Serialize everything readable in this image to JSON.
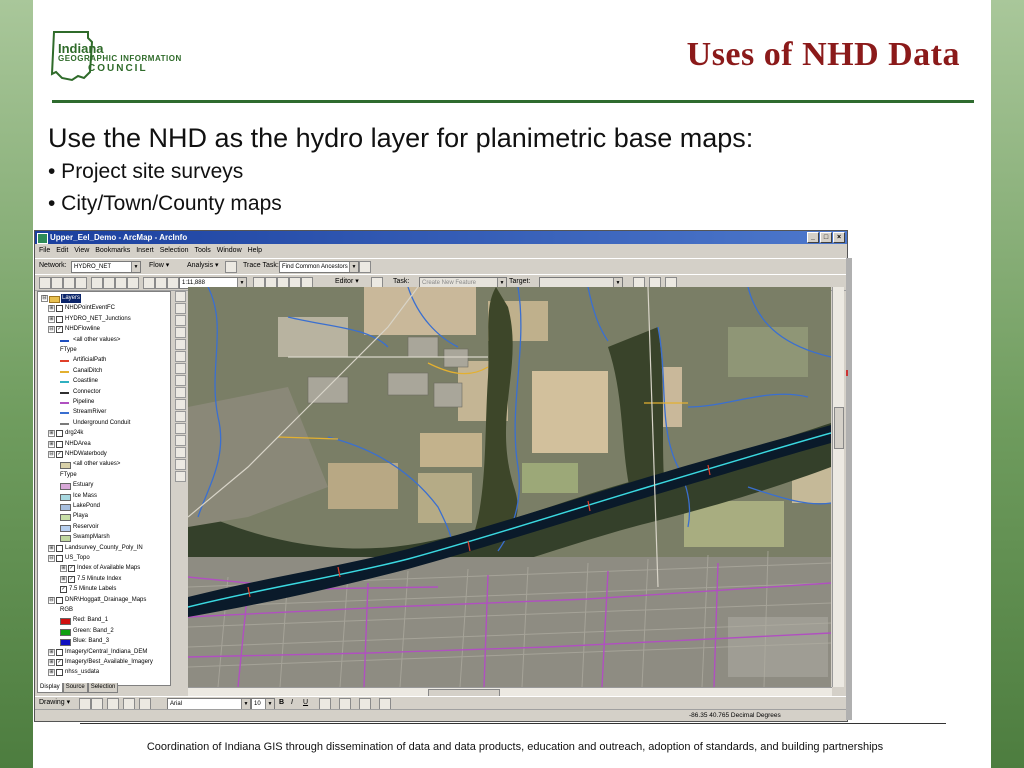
{
  "slide": {
    "title": "Uses of NHD Data",
    "logo_text": {
      "line1": "Indiana",
      "line2": "GEOGRAPHIC INFORMATION",
      "line3": "COUNCIL"
    },
    "heading": "Use the NHD as the hydro layer for planimetric base maps:",
    "bullets": [
      "• Project site surveys",
      "• City/Town/County maps"
    ],
    "footer": "Coordination of Indiana GIS through dissemination of data and data products, education and outreach, adoption of standards, and building partnerships",
    "colors": {
      "title": "#8b1a1a",
      "rule": "#2e6b2e",
      "side_bars": "#6f9c5e"
    }
  },
  "app": {
    "window_title": "Upper_Eel_Demo - ArcMap - ArcInfo",
    "window_buttons": [
      "_",
      "□",
      "×"
    ],
    "menus": [
      "File",
      "Edit",
      "View",
      "Bookmarks",
      "Insert",
      "Selection",
      "Tools",
      "Window",
      "Help"
    ],
    "network_label": "Network:",
    "network_value": "HYDRO_NET",
    "flow_label": "Flow ▾",
    "analysis_label": "Analysis ▾",
    "trace_task_label": "Trace Task:",
    "trace_task_value": "Find Common Ancestors",
    "scale_value": "1:11,888",
    "editor_label": "Editor ▾",
    "task_label": "Task:",
    "task_value": "Create New Feature",
    "target_label": "Target:",
    "draw_label": "Drawing ▾",
    "font_value": "Arial",
    "font_size": "10",
    "format_buttons": [
      "B",
      "I",
      "U"
    ],
    "coordinates": "-86.35  40.765 Decimal Degrees",
    "toc_tabs": [
      "Display",
      "Source",
      "Selection"
    ],
    "toc": [
      {
        "label": "Layers",
        "level": 0,
        "kind": "group",
        "expander": "⊟",
        "selected": true
      },
      {
        "label": "NHDPointEventFC",
        "level": 1,
        "kind": "layer",
        "expander": "⊞",
        "checked": false
      },
      {
        "label": "HYDRO_NET_Junctions",
        "level": 1,
        "kind": "layer",
        "expander": "⊞",
        "checked": false
      },
      {
        "label": "NHDFlowline",
        "level": 1,
        "kind": "layer",
        "expander": "⊟",
        "checked": true
      },
      {
        "label": "<all other values>",
        "level": 2,
        "kind": "legend",
        "symbol": "line",
        "color": "#1f4fbf"
      },
      {
        "label": "FType",
        "level": 2,
        "kind": "legend",
        "symbol": "none"
      },
      {
        "label": "ArtificialPath",
        "level": 2,
        "kind": "legend",
        "symbol": "line",
        "color": "#e0402a"
      },
      {
        "label": "CanalDitch",
        "level": 2,
        "kind": "legend",
        "symbol": "line",
        "color": "#e3b030"
      },
      {
        "label": "Coastline",
        "level": 2,
        "kind": "legend",
        "symbol": "line",
        "color": "#30b0c0"
      },
      {
        "label": "Connector",
        "level": 2,
        "kind": "legend",
        "symbol": "line",
        "color": "#303030"
      },
      {
        "label": "Pipeline",
        "level": 2,
        "kind": "legend",
        "symbol": "line",
        "color": "#b050c0"
      },
      {
        "label": "StreamRiver",
        "level": 2,
        "kind": "legend",
        "symbol": "line",
        "color": "#3a6fd0"
      },
      {
        "label": "Underground Conduit",
        "level": 2,
        "kind": "legend",
        "symbol": "line",
        "color": "#7a7a7a"
      },
      {
        "label": "drg24k",
        "level": 1,
        "kind": "layer",
        "expander": "⊞",
        "checked": false
      },
      {
        "label": "NHDArea",
        "level": 1,
        "kind": "layer",
        "expander": "⊞",
        "checked": false
      },
      {
        "label": "NHDWaterbody",
        "level": 1,
        "kind": "layer",
        "expander": "⊟",
        "checked": true
      },
      {
        "label": "<all other values>",
        "level": 2,
        "kind": "legend",
        "symbol": "fill",
        "color": "#d8d0a8"
      },
      {
        "label": "FType",
        "level": 2,
        "kind": "legend",
        "symbol": "none"
      },
      {
        "label": "Estuary",
        "level": 2,
        "kind": "legend",
        "symbol": "fill",
        "color": "#d8a8d8"
      },
      {
        "label": "Ice Mass",
        "level": 2,
        "kind": "legend",
        "symbol": "fill",
        "color": "#a8d8e0"
      },
      {
        "label": "LakePond",
        "level": 2,
        "kind": "legend",
        "symbol": "fill",
        "color": "#a8c0e0"
      },
      {
        "label": "Playa",
        "level": 2,
        "kind": "legend",
        "symbol": "fill",
        "color": "#c8e0a8"
      },
      {
        "label": "Reservoir",
        "level": 2,
        "kind": "legend",
        "symbol": "fill",
        "color": "#b8d0f0"
      },
      {
        "label": "SwampMarsh",
        "level": 2,
        "kind": "legend",
        "symbol": "fill",
        "color": "#c0d8a0"
      },
      {
        "label": "Landsurvey_County_Poly_IN",
        "level": 1,
        "kind": "layer",
        "expander": "⊞",
        "checked": false
      },
      {
        "label": "US_Topo",
        "level": 1,
        "kind": "layer",
        "expander": "⊟",
        "checked": false
      },
      {
        "label": "Index of Available Maps",
        "level": 2,
        "kind": "layer",
        "expander": "⊞",
        "checked": true
      },
      {
        "label": "7.5 Minute Index",
        "level": 2,
        "kind": "layer",
        "expander": "⊞",
        "checked": true
      },
      {
        "label": "7.5 Minute Labels",
        "level": 2,
        "kind": "layer",
        "expander": "",
        "checked": true
      },
      {
        "label": "DNR\\Hoggatt_Drainage_Maps",
        "level": 1,
        "kind": "layer",
        "expander": "⊟",
        "checked": false
      },
      {
        "label": "RGB",
        "level": 2,
        "kind": "legend",
        "symbol": "none"
      },
      {
        "label": "Red:   Band_1",
        "level": 2,
        "kind": "legend",
        "symbol": "fill",
        "color": "#d01010"
      },
      {
        "label": "Green: Band_2",
        "level": 2,
        "kind": "legend",
        "symbol": "fill",
        "color": "#10a010"
      },
      {
        "label": "Blue:  Band_3",
        "level": 2,
        "kind": "legend",
        "symbol": "fill",
        "color": "#1010c0"
      },
      {
        "label": "Imagery/Central_Indiana_DEM",
        "level": 1,
        "kind": "layer",
        "expander": "⊞",
        "checked": false
      },
      {
        "label": "Imagery/Best_Available_Imagery",
        "level": 1,
        "kind": "layer",
        "expander": "⊞",
        "checked": true
      },
      {
        "label": "nhss_usdata",
        "level": 1,
        "kind": "layer",
        "expander": "⊞",
        "checked": false
      }
    ],
    "map_colors": {
      "river": "#0a1a2a",
      "river_line": "#3ad8e0",
      "streams": "#3a6fd0",
      "roads": "#b050c0",
      "canals": "#e3b030",
      "artificial": "#e0402a",
      "vegetation": "#3f4a2a",
      "fields": "#c9b89a",
      "urban": "#8c8a80"
    }
  }
}
